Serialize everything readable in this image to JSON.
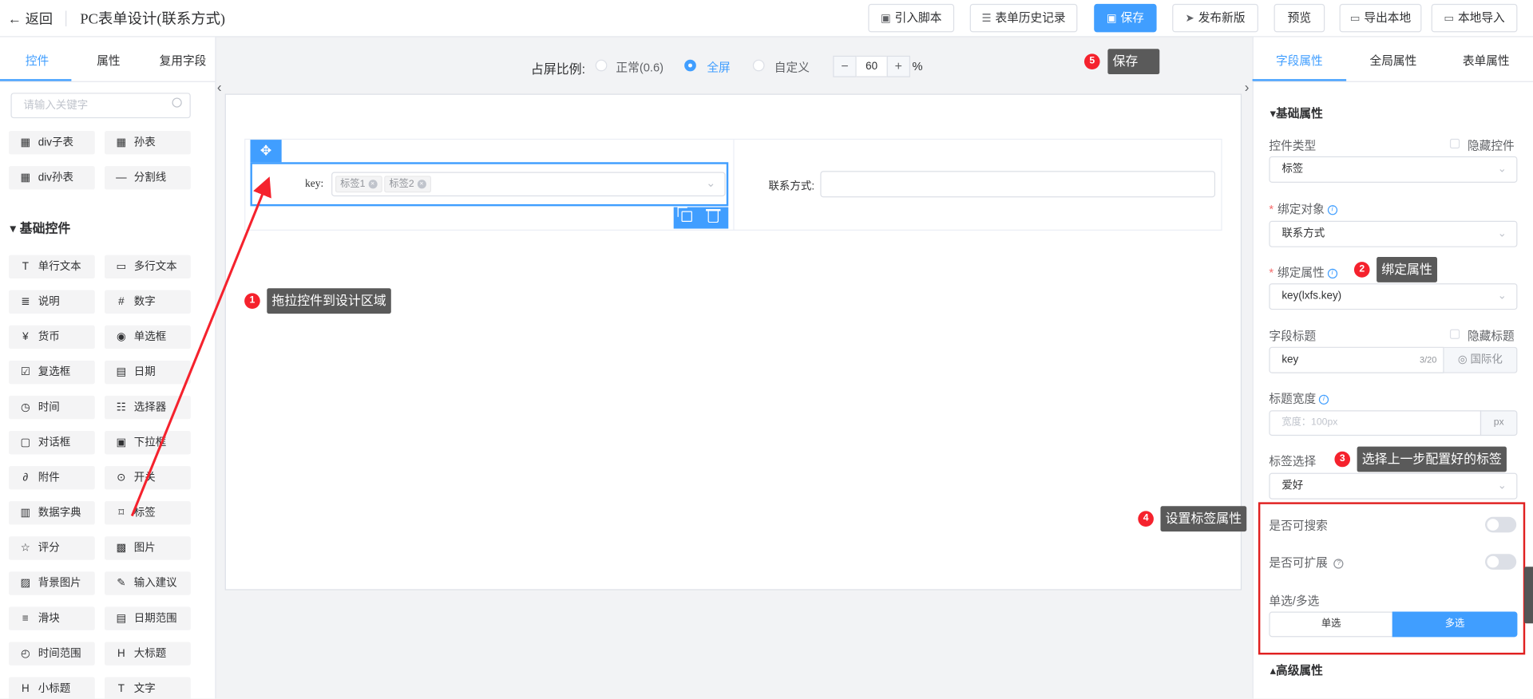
{
  "header": {
    "back_label": "返回",
    "page_title": "PC表单设计(联系方式)",
    "buttons": {
      "import_script": "引入脚本",
      "history": "表单历史记录",
      "save": "保存",
      "publish": "发布新版",
      "preview": "预览",
      "export_local": "导出本地",
      "import_local": "本地导入"
    }
  },
  "left_panel": {
    "tabs": [
      "控件",
      "属性",
      "复用字段"
    ],
    "active_tab": "控件",
    "search_placeholder": "请输入关键字",
    "table_widgets": [
      {
        "label": "div子表",
        "icon": "grid-icon"
      },
      {
        "label": "孙表",
        "icon": "grid-icon"
      },
      {
        "label": "div孙表",
        "icon": "grid-icon"
      },
      {
        "label": "分割线",
        "icon": "divider-icon"
      }
    ],
    "basic_section": "基础控件",
    "basic_widgets": [
      {
        "label": "单行文本",
        "icon": "text-icon"
      },
      {
        "label": "多行文本",
        "icon": "textarea-icon"
      },
      {
        "label": "说明",
        "icon": "note-icon"
      },
      {
        "label": "数字",
        "icon": "number-icon"
      },
      {
        "label": "货币",
        "icon": "currency-icon"
      },
      {
        "label": "单选框",
        "icon": "radio-icon"
      },
      {
        "label": "复选框",
        "icon": "checkbox-icon"
      },
      {
        "label": "日期",
        "icon": "calendar-icon"
      },
      {
        "label": "时间",
        "icon": "clock-icon"
      },
      {
        "label": "选择器",
        "icon": "selector-icon"
      },
      {
        "label": "对话框",
        "icon": "dialog-icon"
      },
      {
        "label": "下拉框",
        "icon": "dropdown-icon"
      },
      {
        "label": "附件",
        "icon": "paperclip-icon"
      },
      {
        "label": "开关",
        "icon": "toggle-icon"
      },
      {
        "label": "数据字典",
        "icon": "dictionary-icon"
      },
      {
        "label": "标签",
        "icon": "bookmark-icon"
      },
      {
        "label": "评分",
        "icon": "star-icon"
      },
      {
        "label": "图片",
        "icon": "image-icon"
      },
      {
        "label": "背景图片",
        "icon": "background-image-icon"
      },
      {
        "label": "输入建议",
        "icon": "pen-icon"
      },
      {
        "label": "滑块",
        "icon": "slider-icon"
      },
      {
        "label": "日期范围",
        "icon": "date-range-icon"
      },
      {
        "label": "时间范围",
        "icon": "time-range-icon"
      },
      {
        "label": "大标题",
        "icon": "heading-icon"
      },
      {
        "label": "小标题",
        "icon": "subheading-icon"
      },
      {
        "label": "文字",
        "icon": "text-block-icon"
      }
    ]
  },
  "canvas": {
    "ratio_label": "占屏比例:",
    "ratio_options": [
      "正常(0.6)",
      "全屏",
      "自定义"
    ],
    "ratio_selected": "全屏",
    "zoom_minus": "−",
    "zoom_value": "60",
    "zoom_plus": "+",
    "zoom_unit": "%",
    "field_key_label": "key:",
    "tags": [
      "标签1",
      "标签2"
    ],
    "contact_label": "联系方式:"
  },
  "annotations": [
    {
      "num": "1",
      "text": "拖拉控件到设计区域"
    },
    {
      "num": "2",
      "text": "绑定属性"
    },
    {
      "num": "3",
      "text": "选择上一步配置好的标签"
    },
    {
      "num": "4",
      "text": "设置标签属性"
    },
    {
      "num": "5",
      "text": "保存"
    }
  ],
  "right_panel": {
    "tabs": [
      "字段属性",
      "全局属性",
      "表单属性"
    ],
    "active_tab": "字段属性",
    "basic_section": "基础属性",
    "control_type_label": "控件类型",
    "hide_control_label": "隐藏控件",
    "control_type_value": "标签",
    "bind_object_label": "绑定对象",
    "bind_object_value": "联系方式",
    "bind_attr_label": "绑定属性",
    "bind_attr_value": "key(lxfs.key)",
    "field_title_label": "字段标题",
    "hide_title_label": "隐藏标题",
    "field_title_value": "key",
    "field_title_count": "3/20",
    "i18n_label": "国际化",
    "title_width_label": "标题宽度",
    "title_width_placeholder": "宽度：100px",
    "title_width_unit": "px",
    "tag_select_label": "标签选择",
    "tag_select_value": "爱好",
    "searchable_label": "是否可搜索",
    "expandable_label": "是否可扩展",
    "mode_label": "单选/多选",
    "mode_single": "单选",
    "mode_multi": "多选",
    "mode_selected": "多选",
    "searchable_on": false,
    "expandable_on": false,
    "advanced_section": "高级属性"
  },
  "colors": {
    "primary": "#409eff",
    "badge": "#f5222d",
    "highlight_box": "#e02020",
    "tooltip_bg": "#5a5a5a"
  }
}
